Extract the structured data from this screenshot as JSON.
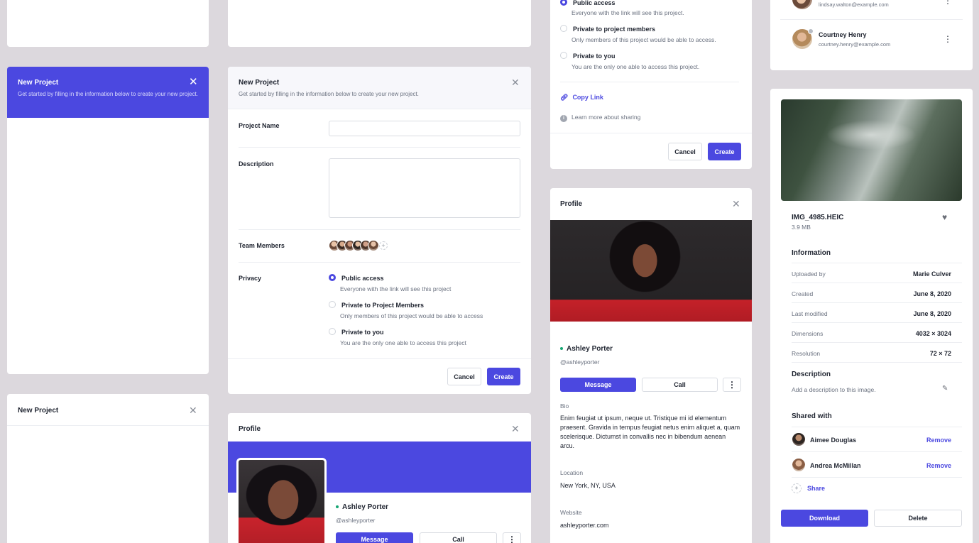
{
  "new_project": {
    "title": "New Project",
    "subtitle": "Get started by filling in the information below to create your new project.",
    "fields": {
      "project_name_label": "Project Name",
      "description_label": "Description",
      "team_members_label": "Team Members",
      "privacy_label": "Privacy"
    },
    "privacy_options": [
      {
        "label": "Public access",
        "desc": "Everyone with the link will see this project"
      },
      {
        "label": "Private to Project Members",
        "desc": "Only members of this project would be able to access"
      },
      {
        "label": "Private to you",
        "desc": "You are the only one able to access this project"
      }
    ],
    "cancel_label": "Cancel",
    "create_label": "Create",
    "add_member_glyph": "+"
  },
  "share_panel": {
    "options": [
      {
        "label": "Public access",
        "desc": "Everyone with the link will see this project."
      },
      {
        "label": "Private to project members",
        "desc": "Only members of this project would be able to access."
      },
      {
        "label": "Private to you",
        "desc": "You are the only one able to access this project."
      }
    ],
    "copy_link_label": "Copy Link",
    "learn_more_label": "Learn more about sharing",
    "cancel_label": "Cancel",
    "create_label": "Create"
  },
  "contacts": [
    {
      "name": "",
      "email": "lindsay.walton@example.com"
    },
    {
      "name": "Courtney Henry",
      "email": "courtney.henry@example.com"
    }
  ],
  "profile": {
    "title": "Profile",
    "name": "Ashley Porter",
    "handle": "@ashleyporter",
    "message_label": "Message",
    "call_label": "Call",
    "more_glyph": "⋮",
    "bio_label": "Bio",
    "bio": "Enim feugiat ut ipsum, neque ut. Tristique mi id elementum praesent. Gravida in tempus feugiat netus enim aliquet a, quam scelerisque. Dictumst in convallis nec in bibendum aenean arcu.",
    "location_label": "Location",
    "location": "New York, NY, USA",
    "website_label": "Website",
    "website": "ashleyporter.com"
  },
  "file_details": {
    "file_name": "IMG_4985.HEIC",
    "file_size": "3.9 MB",
    "information_heading": "Information",
    "info_rows": [
      {
        "label": "Uploaded by",
        "value": "Marie Culver"
      },
      {
        "label": "Created",
        "value": "June 8, 2020"
      },
      {
        "label": "Last modified",
        "value": "June 8, 2020"
      },
      {
        "label": "Dimensions",
        "value": "4032 × 3024"
      },
      {
        "label": "Resolution",
        "value": "72 × 72"
      }
    ],
    "description_heading": "Description",
    "description_placeholder": "Add a description to this image.",
    "shared_heading": "Shared with",
    "shared": [
      {
        "name": "Aimee Douglas",
        "action": "Remove"
      },
      {
        "name": "Andrea McMillan",
        "action": "Remove"
      }
    ],
    "share_label": "Share",
    "download_label": "Download",
    "delete_label": "Delete"
  },
  "colors": {
    "accent": "#4b48e0",
    "online": "#17a673",
    "background": "#dcd8dd"
  }
}
